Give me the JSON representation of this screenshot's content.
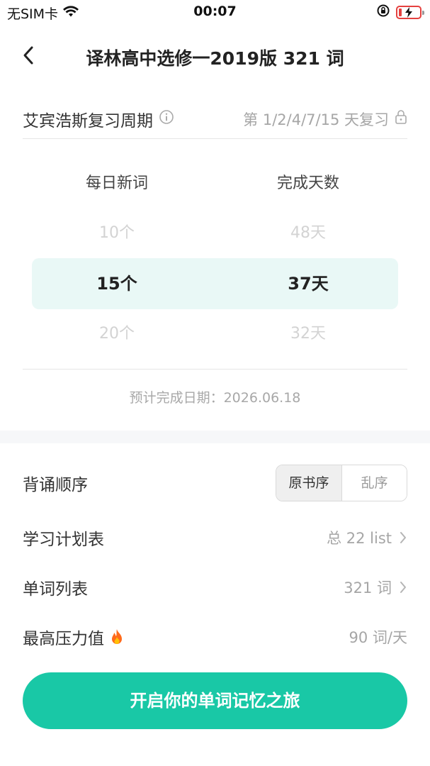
{
  "status_bar": {
    "carrier": "无SIM卡",
    "time": "00:07"
  },
  "nav": {
    "title": "译林高中选修一2019版 321 词"
  },
  "review_cycle": {
    "label": "艾宾浩斯复习周期",
    "value": "第 1/2/4/7/15 天复习"
  },
  "picker": {
    "col_daily_title": "每日新词",
    "col_days_title": "完成天数",
    "rows": [
      {
        "daily": "10个",
        "days": "48天"
      },
      {
        "daily": "15个",
        "days": "37天"
      },
      {
        "daily": "20个",
        "days": "32天"
      }
    ],
    "selected_index": 1
  },
  "estimate": "预计完成日期：2026.06.18",
  "settings": {
    "order_label": "背诵顺序",
    "order_options": [
      "原书序",
      "乱序"
    ],
    "order_selected": "原书序",
    "plan_label": "学习计划表",
    "plan_value": "总 22 list",
    "wordlist_label": "单词列表",
    "wordlist_value": "321 词",
    "pressure_label": "最高压力值",
    "pressure_value": "90 词/天"
  },
  "cta_label": "开启你的单词记忆之旅",
  "colors": {
    "accent": "#19c8a6",
    "selected_row_bg": "#e9f8f6",
    "battery_low": "#e5413f",
    "fire": "#ff6a1a"
  },
  "icons": [
    "wifi-icon",
    "rotation-lock-icon",
    "battery-icon",
    "back-arrow-icon",
    "info-icon",
    "lock-icon",
    "chevron-right-icon",
    "fire-icon"
  ]
}
